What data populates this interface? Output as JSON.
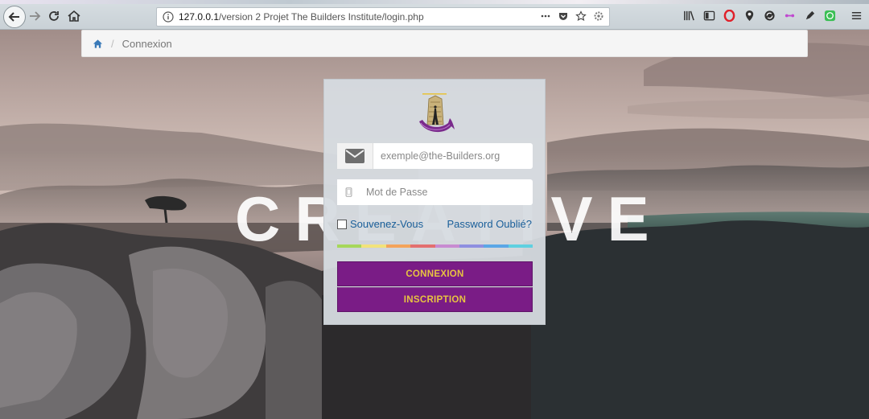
{
  "browser": {
    "url_host": "127.0.0.1",
    "url_path": "/version 2 Projet The Builders Institute/login.php"
  },
  "breadcrumb": {
    "home_icon": "home-icon",
    "current": "Connexion"
  },
  "background": {
    "word": "CREATIVE"
  },
  "login": {
    "email_placeholder": "exemple@the-Builders.org",
    "password_placeholder": "Mot de Passe",
    "remember_label": "Souvenez-Vous",
    "forgot_label": "Password Oublié?",
    "login_button": "CONNEXION",
    "signup_button": "INSCRIPTION"
  },
  "colors": {
    "button_bg": "#7a1c86",
    "button_text": "#e7c341",
    "link": "#1a5f9a",
    "rainbow": [
      "#a6d75a",
      "#f2e27a",
      "#f4a35a",
      "#e36f6f",
      "#c88bd1",
      "#8e8fe0",
      "#5ba7e6",
      "#5fd0e0"
    ]
  }
}
